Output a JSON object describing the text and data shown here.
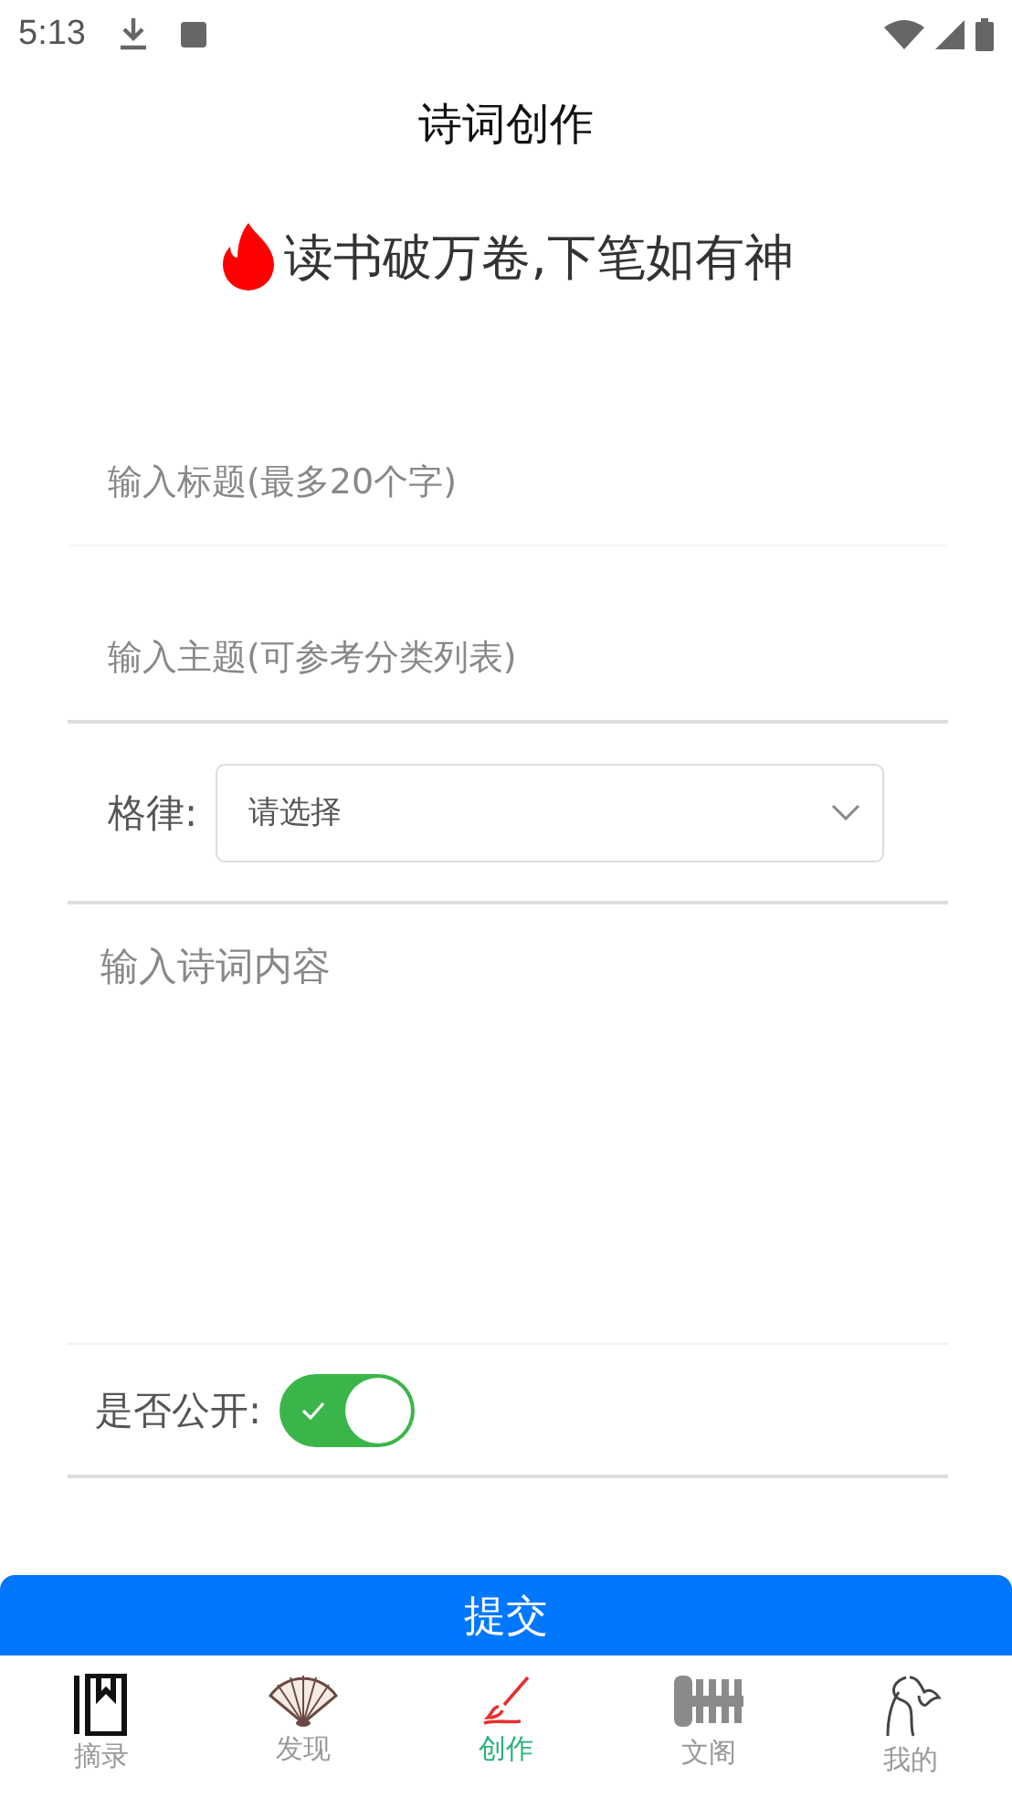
{
  "status_bar": {
    "time": "5:13"
  },
  "header": {
    "title": "诗词创作"
  },
  "motto": "读书破万卷,下笔如有神",
  "form": {
    "title_field": {
      "placeholder": "输入标题(最多20个字)"
    },
    "theme_field": {
      "placeholder": "输入主题(可参考分类列表)"
    },
    "meter": {
      "label": "格律:",
      "placeholder": "请选择"
    },
    "content_field": {
      "placeholder": "输入诗词内容"
    },
    "public": {
      "label": "是否公开:",
      "on": true
    }
  },
  "submit_button": "提交",
  "tabs": [
    {
      "label": "摘录",
      "kind": "book",
      "selected": false
    },
    {
      "label": "发现",
      "kind": "fan",
      "selected": false
    },
    {
      "label": "创作",
      "kind": "brush",
      "selected": true
    },
    {
      "label": "文阁",
      "kind": "scroll",
      "selected": false
    },
    {
      "label": "我的",
      "kind": "figure",
      "selected": false
    }
  ]
}
